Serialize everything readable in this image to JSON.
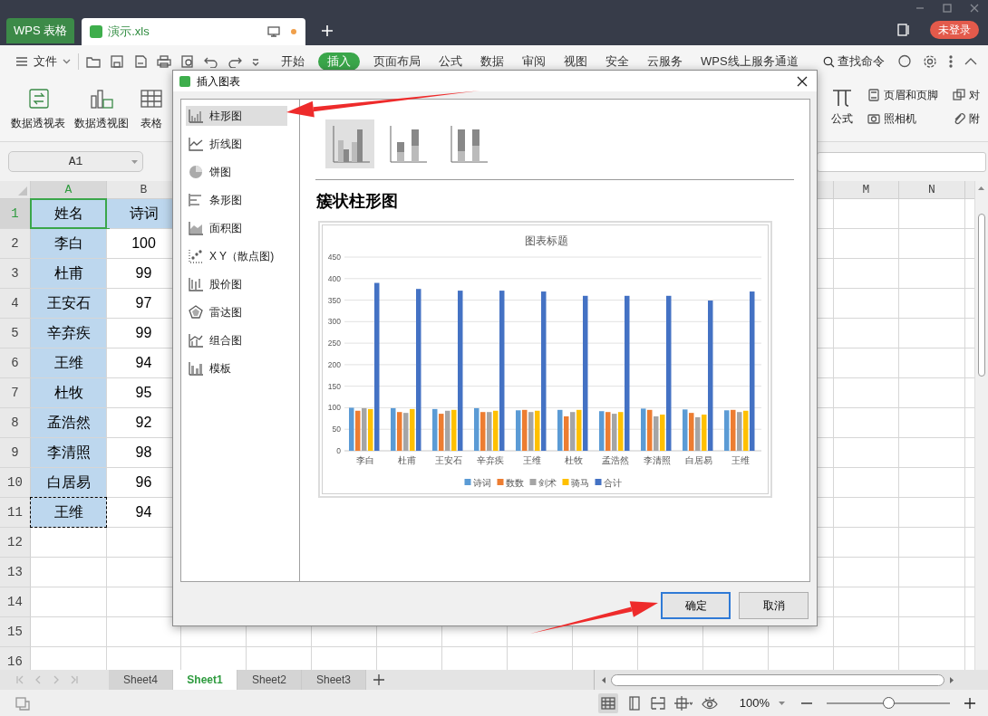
{
  "app_tabs": [
    {
      "label": "WPS 表格",
      "kind": "home",
      "selected": false,
      "modified": false
    },
    {
      "label": "演示.xls",
      "kind": "document",
      "selected": true,
      "modified": true
    }
  ],
  "account": {
    "label": "未登录"
  },
  "menu": {
    "file": "文件",
    "items": [
      {
        "label": "开始",
        "selected": false
      },
      {
        "label": "插入",
        "selected": true
      },
      {
        "label": "页面布局",
        "selected": false
      },
      {
        "label": "公式",
        "selected": false
      },
      {
        "label": "数据",
        "selected": false
      },
      {
        "label": "审阅",
        "selected": false
      },
      {
        "label": "视图",
        "selected": false
      },
      {
        "label": "安全",
        "selected": false
      },
      {
        "label": "云服务",
        "selected": false
      },
      {
        "label": "WPS线上服务通道",
        "selected": false
      }
    ],
    "search": "查找命令"
  },
  "ribbon": {
    "left": [
      {
        "label": "数据透视表"
      },
      {
        "label": "数据透视图"
      },
      {
        "label": "表格"
      }
    ],
    "right": [
      {
        "label": "公式",
        "kind": "large"
      },
      {
        "label": "页眉和页脚",
        "kind": "small"
      },
      {
        "label": "照相机",
        "kind": "small"
      },
      {
        "label": "对",
        "kind": "small"
      },
      {
        "label": "附",
        "kind": "small"
      }
    ]
  },
  "name_box": "A1",
  "sheet": {
    "columns": [
      {
        "label": "A",
        "active": true
      },
      {
        "label": "B",
        "active": false
      },
      {
        "label": "M",
        "active": false
      },
      {
        "label": "N",
        "active": false
      }
    ],
    "rows": [
      {
        "number": "1",
        "cells": [
          {
            "text": "姓名",
            "selected": true,
            "active": true,
            "marquee": false
          },
          {
            "text": "诗词",
            "selected": true,
            "active": false,
            "marquee": false
          }
        ]
      },
      {
        "number": "2",
        "cells": [
          {
            "text": "李白",
            "selected": true,
            "active": false,
            "marquee": false
          },
          {
            "text": "100",
            "selected": false,
            "active": false,
            "marquee": false
          }
        ]
      },
      {
        "number": "3",
        "cells": [
          {
            "text": "杜甫",
            "selected": true,
            "active": false,
            "marquee": false
          },
          {
            "text": "99",
            "selected": false,
            "active": false,
            "marquee": false
          }
        ]
      },
      {
        "number": "4",
        "cells": [
          {
            "text": "王安石",
            "selected": true,
            "active": false,
            "marquee": false
          },
          {
            "text": "97",
            "selected": false,
            "active": false,
            "marquee": false
          }
        ]
      },
      {
        "number": "5",
        "cells": [
          {
            "text": "辛弃疾",
            "selected": true,
            "active": false,
            "marquee": false
          },
          {
            "text": "99",
            "selected": false,
            "active": false,
            "marquee": false
          }
        ]
      },
      {
        "number": "6",
        "cells": [
          {
            "text": "王维",
            "selected": true,
            "active": false,
            "marquee": false
          },
          {
            "text": "94",
            "selected": false,
            "active": false,
            "marquee": false
          }
        ]
      },
      {
        "number": "7",
        "cells": [
          {
            "text": "杜牧",
            "selected": true,
            "active": false,
            "marquee": false
          },
          {
            "text": "95",
            "selected": false,
            "active": false,
            "marquee": false
          }
        ]
      },
      {
        "number": "8",
        "cells": [
          {
            "text": "孟浩然",
            "selected": true,
            "active": false,
            "marquee": false
          },
          {
            "text": "92",
            "selected": false,
            "active": false,
            "marquee": false
          }
        ]
      },
      {
        "number": "9",
        "cells": [
          {
            "text": "李清照",
            "selected": true,
            "active": false,
            "marquee": false
          },
          {
            "text": "98",
            "selected": false,
            "active": false,
            "marquee": false
          }
        ]
      },
      {
        "number": "10",
        "cells": [
          {
            "text": "白居易",
            "selected": true,
            "active": false,
            "marquee": false
          },
          {
            "text": "96",
            "selected": false,
            "active": false,
            "marquee": false
          }
        ]
      },
      {
        "number": "11",
        "cells": [
          {
            "text": "王维",
            "selected": true,
            "active": false,
            "marquee": true
          },
          {
            "text": "94",
            "selected": false,
            "active": false,
            "marquee": false
          }
        ]
      },
      {
        "number": "12"
      },
      {
        "number": "13"
      },
      {
        "number": "14"
      },
      {
        "number": "15"
      },
      {
        "number": "16"
      }
    ]
  },
  "sheet_tabs": [
    {
      "label": "Sheet4",
      "selected": false
    },
    {
      "label": "Sheet1",
      "selected": true
    },
    {
      "label": "Sheet2",
      "selected": false
    },
    {
      "label": "Sheet3",
      "selected": false
    }
  ],
  "status_bar": {
    "zoom": "100%",
    "zoom_slider": {
      "level": 0.5
    }
  },
  "dialog": {
    "title": "插入图表",
    "chart_types": [
      {
        "label": "柱形图",
        "kind": "column",
        "selected": true
      },
      {
        "label": "折线图",
        "kind": "line",
        "selected": false
      },
      {
        "label": "饼图",
        "kind": "pie",
        "selected": false
      },
      {
        "label": "条形图",
        "kind": "bar",
        "selected": false
      },
      {
        "label": "面积图",
        "kind": "area",
        "selected": false
      },
      {
        "label": "X Y（散点图)",
        "kind": "scatter",
        "selected": false
      },
      {
        "label": "股价图",
        "kind": "stock",
        "selected": false
      },
      {
        "label": "雷达图",
        "kind": "radar",
        "selected": false
      },
      {
        "label": "组合图",
        "kind": "combo",
        "selected": false
      },
      {
        "label": "模板",
        "kind": "template",
        "selected": false
      }
    ],
    "subtypes": [
      {
        "kind": "clustered",
        "selected": true
      },
      {
        "kind": "stacked",
        "selected": false
      },
      {
        "kind": "percent",
        "selected": false
      }
    ],
    "heading": "簇状柱形图",
    "chart_data": {
      "type": "bar",
      "title": "图表标题",
      "categories": [
        "李白",
        "杜甫",
        "王安石",
        "辛弃疾",
        "王维",
        "杜牧",
        "孟浩然",
        "李清照",
        "白居易",
        "王维"
      ],
      "series": [
        {
          "name": "诗词",
          "color": "#5b9bd5",
          "values": [
            100,
            99,
            97,
            99,
            94,
            95,
            92,
            98,
            96,
            94
          ]
        },
        {
          "name": "数数",
          "color": "#ed7d31",
          "values": [
            93,
            90,
            86,
            90,
            95,
            80,
            90,
            95,
            88,
            95
          ]
        },
        {
          "name": "剑术",
          "color": "#a5a5a5",
          "values": [
            99,
            88,
            93,
            90,
            90,
            90,
            86,
            80,
            78,
            90
          ]
        },
        {
          "name": "骑马",
          "color": "#ffc000",
          "values": [
            97,
            97,
            95,
            93,
            93,
            95,
            90,
            84,
            84,
            93
          ]
        },
        {
          "name": "合计",
          "color": "#4472c4",
          "values": [
            390,
            376,
            372,
            372,
            370,
            360,
            360,
            360,
            349,
            370
          ]
        }
      ],
      "ylim": [
        0,
        450
      ],
      "yticks": [
        0,
        50,
        100,
        150,
        200,
        250,
        300,
        350,
        400,
        450
      ],
      "grid": true,
      "legend": true
    },
    "buttons": [
      {
        "label": "确定",
        "kind": "primary"
      },
      {
        "label": "取消",
        "kind": "secondary"
      }
    ]
  }
}
